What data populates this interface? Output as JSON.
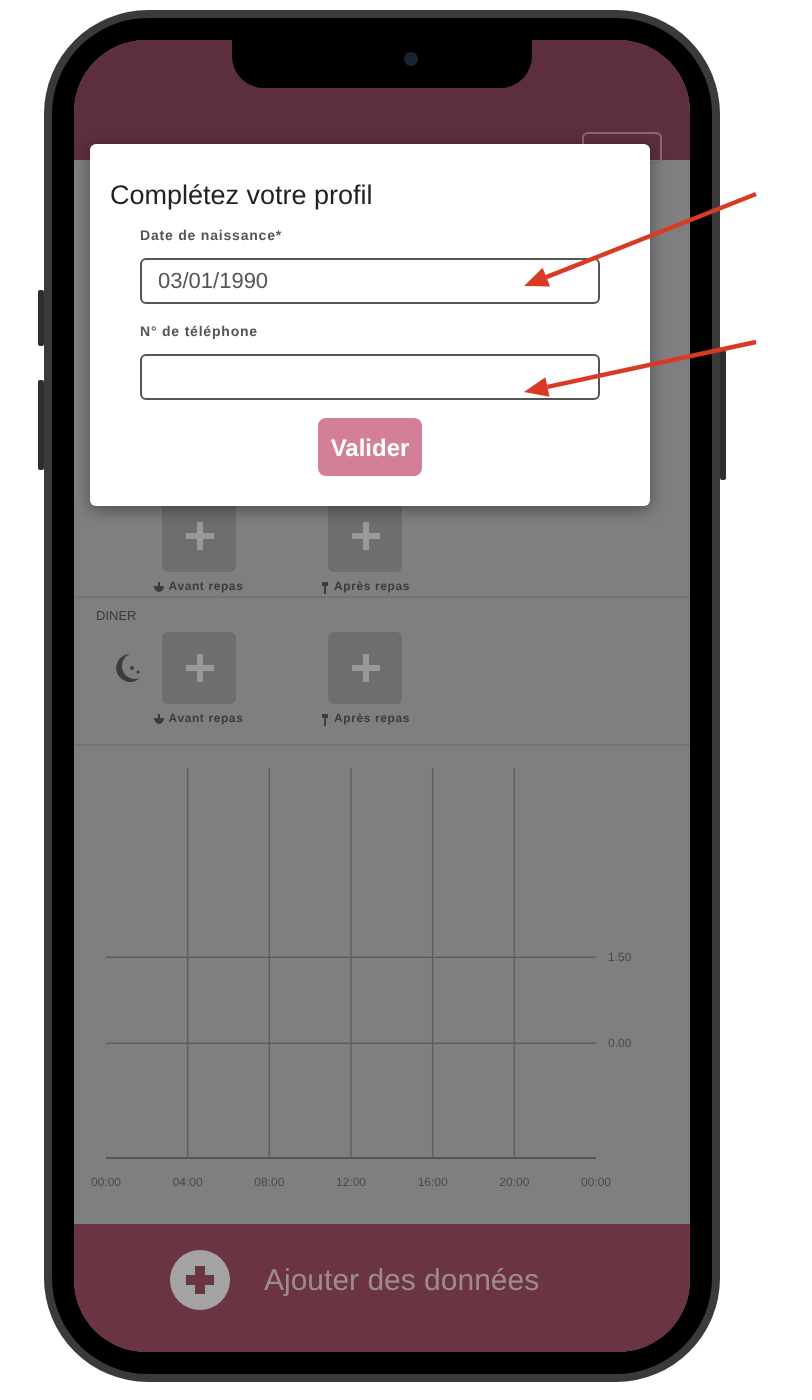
{
  "dialog": {
    "title": "Complétez votre profil",
    "fields": [
      {
        "label": "Date de naissance*",
        "value": "03/01/1990"
      },
      {
        "label": "N° de téléphone"
      }
    ],
    "submit": "Valider"
  },
  "meals": [
    {
      "slots": [
        {
          "kind": "before",
          "label": "Avant repas"
        },
        {
          "kind": "after",
          "label": "Après repas"
        }
      ]
    },
    {
      "kind": "dinner",
      "name": "DINER",
      "slots": [
        {
          "kind": "before",
          "label": "Avant repas"
        },
        {
          "kind": "after",
          "label": "Après repas"
        }
      ]
    }
  ],
  "chart": {
    "chart_data": {
      "type": "line",
      "grid": true,
      "xlim": [
        0,
        24
      ],
      "ylim": [
        -2,
        4.8
      ],
      "xticks": [
        {
          "value": 0,
          "label": "00:00"
        },
        {
          "value": 4,
          "label": "04:00"
        },
        {
          "value": 8,
          "label": "08:00"
        },
        {
          "value": 12,
          "label": "12:00"
        },
        {
          "value": 16,
          "label": "16:00"
        },
        {
          "value": 20,
          "label": "20:00"
        },
        {
          "value": 24,
          "label": "00:00"
        }
      ],
      "yticks": [
        {
          "value": 0,
          "label": "0.00"
        },
        {
          "value": 1.5,
          "label": "1.50"
        }
      ]
    }
  },
  "bottom_bar": {
    "label": "Ajouter des données"
  },
  "annotations": [
    {
      "kind": "arrow"
    },
    {
      "kind": "arrow"
    }
  ]
}
